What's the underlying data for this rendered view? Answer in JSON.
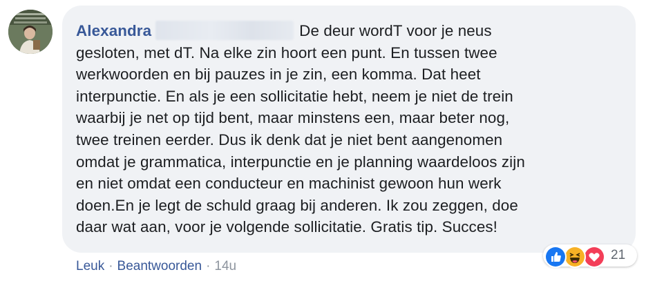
{
  "comment": {
    "author": "Alexandra",
    "lines": [
      "De deur wordT voor je neus",
      "gesloten, met dT. Na elke zin hoort een punt. En tussen twee",
      "werkwoorden en bij pauzes in je zin, een komma. Dat heet",
      "interpunctie. En als je een sollicitatie hebt, neem je niet de trein",
      "waarbij je net op tijd bent, maar minstens een, maar beter nog,",
      "twee treinen eerder. Dus ik denk dat je niet bent aangenomen",
      "omdat je grammatica, interpunctie en je planning waardeloos zijn",
      "en niet omdat een conducteur en machinist gewoon hun werk",
      "doen.En je legt de schuld graag bij anderen. Ik zou zeggen, doe",
      "daar wat aan, voor je volgende sollicitatie. Gratis tip. Succes!"
    ]
  },
  "actions": {
    "like": "Leuk",
    "reply": "Beantwoorden",
    "separator": "·",
    "time": "14u"
  },
  "reactions": {
    "icons": [
      "like-icon",
      "haha-icon",
      "love-icon"
    ],
    "count": "21"
  },
  "colors": {
    "link": "#385898",
    "text": "#1c1e21",
    "muted": "#8d949e",
    "bubble": "#f0f2f5"
  }
}
